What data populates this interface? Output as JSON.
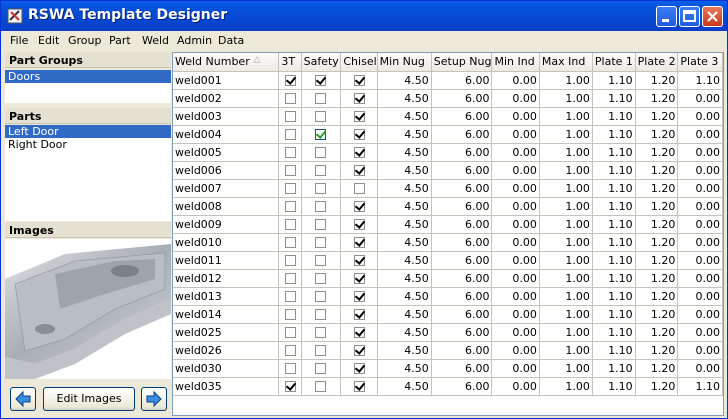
{
  "window": {
    "title": "RSWA Template Designer"
  },
  "menu": [
    "File",
    "Edit",
    "Group",
    "Part",
    "Weld",
    "Admin",
    "Data"
  ],
  "part_groups": {
    "header": "Part Groups",
    "items": [
      "Doors"
    ],
    "selected": 0
  },
  "parts": {
    "header": "Parts",
    "items": [
      "Left Door",
      "Right Door"
    ],
    "selected": 0
  },
  "images": {
    "header": "Images",
    "edit_button": "Edit Images"
  },
  "table": {
    "columns": [
      "Weld Number",
      "3T",
      "Safety",
      "Chisel",
      "Min Nug",
      "Setup Nug",
      "Min Ind",
      "Max Ind",
      "Plate 1",
      "Plate 2",
      "Plate 3"
    ],
    "rows": [
      {
        "weld": "weld001",
        "t3": true,
        "safety": true,
        "chisel": true,
        "min_nug": "4.50",
        "setup_nug": "6.00",
        "min_ind": "0.00",
        "max_ind": "1.00",
        "p1": "1.10",
        "p2": "1.20",
        "p3": "1.10"
      },
      {
        "weld": "weld002",
        "t3": false,
        "safety": false,
        "chisel": true,
        "min_nug": "4.50",
        "setup_nug": "6.00",
        "min_ind": "0.00",
        "max_ind": "1.00",
        "p1": "1.10",
        "p2": "1.20",
        "p3": "0.00"
      },
      {
        "weld": "weld003",
        "t3": false,
        "safety": false,
        "chisel": true,
        "min_nug": "4.50",
        "setup_nug": "6.00",
        "min_ind": "0.00",
        "max_ind": "1.00",
        "p1": "1.10",
        "p2": "1.20",
        "p3": "0.00"
      },
      {
        "weld": "weld004",
        "t3": false,
        "safety": true,
        "chisel": true,
        "min_nug": "4.50",
        "setup_nug": "6.00",
        "min_ind": "0.00",
        "max_ind": "1.00",
        "p1": "1.10",
        "p2": "1.20",
        "p3": "0.00",
        "safety_focus": true
      },
      {
        "weld": "weld005",
        "t3": false,
        "safety": false,
        "chisel": true,
        "min_nug": "4.50",
        "setup_nug": "6.00",
        "min_ind": "0.00",
        "max_ind": "1.00",
        "p1": "1.10",
        "p2": "1.20",
        "p3": "0.00"
      },
      {
        "weld": "weld006",
        "t3": false,
        "safety": false,
        "chisel": true,
        "min_nug": "4.50",
        "setup_nug": "6.00",
        "min_ind": "0.00",
        "max_ind": "1.00",
        "p1": "1.10",
        "p2": "1.20",
        "p3": "0.00"
      },
      {
        "weld": "weld007",
        "t3": false,
        "safety": false,
        "chisel": false,
        "min_nug": "4.50",
        "setup_nug": "6.00",
        "min_ind": "0.00",
        "max_ind": "1.00",
        "p1": "1.10",
        "p2": "1.20",
        "p3": "0.00"
      },
      {
        "weld": "weld008",
        "t3": false,
        "safety": false,
        "chisel": true,
        "min_nug": "4.50",
        "setup_nug": "6.00",
        "min_ind": "0.00",
        "max_ind": "1.00",
        "p1": "1.10",
        "p2": "1.20",
        "p3": "0.00"
      },
      {
        "weld": "weld009",
        "t3": false,
        "safety": false,
        "chisel": true,
        "min_nug": "4.50",
        "setup_nug": "6.00",
        "min_ind": "0.00",
        "max_ind": "1.00",
        "p1": "1.10",
        "p2": "1.20",
        "p3": "0.00"
      },
      {
        "weld": "weld010",
        "t3": false,
        "safety": false,
        "chisel": true,
        "min_nug": "4.50",
        "setup_nug": "6.00",
        "min_ind": "0.00",
        "max_ind": "1.00",
        "p1": "1.10",
        "p2": "1.20",
        "p3": "0.00"
      },
      {
        "weld": "weld011",
        "t3": false,
        "safety": false,
        "chisel": true,
        "min_nug": "4.50",
        "setup_nug": "6.00",
        "min_ind": "0.00",
        "max_ind": "1.00",
        "p1": "1.10",
        "p2": "1.20",
        "p3": "0.00"
      },
      {
        "weld": "weld012",
        "t3": false,
        "safety": false,
        "chisel": true,
        "min_nug": "4.50",
        "setup_nug": "6.00",
        "min_ind": "0.00",
        "max_ind": "1.00",
        "p1": "1.10",
        "p2": "1.20",
        "p3": "0.00"
      },
      {
        "weld": "weld013",
        "t3": false,
        "safety": false,
        "chisel": true,
        "min_nug": "4.50",
        "setup_nug": "6.00",
        "min_ind": "0.00",
        "max_ind": "1.00",
        "p1": "1.10",
        "p2": "1.20",
        "p3": "0.00"
      },
      {
        "weld": "weld014",
        "t3": false,
        "safety": false,
        "chisel": true,
        "min_nug": "4.50",
        "setup_nug": "6.00",
        "min_ind": "0.00",
        "max_ind": "1.00",
        "p1": "1.10",
        "p2": "1.20",
        "p3": "0.00"
      },
      {
        "weld": "weld025",
        "t3": false,
        "safety": false,
        "chisel": true,
        "min_nug": "4.50",
        "setup_nug": "6.00",
        "min_ind": "0.00",
        "max_ind": "1.00",
        "p1": "1.10",
        "p2": "1.20",
        "p3": "0.00"
      },
      {
        "weld": "weld026",
        "t3": false,
        "safety": false,
        "chisel": true,
        "min_nug": "4.50",
        "setup_nug": "6.00",
        "min_ind": "0.00",
        "max_ind": "1.00",
        "p1": "1.10",
        "p2": "1.20",
        "p3": "0.00"
      },
      {
        "weld": "weld030",
        "t3": false,
        "safety": false,
        "chisel": true,
        "min_nug": "4.50",
        "setup_nug": "6.00",
        "min_ind": "0.00",
        "max_ind": "1.00",
        "p1": "1.10",
        "p2": "1.20",
        "p3": "0.00"
      },
      {
        "weld": "weld035",
        "t3": true,
        "safety": false,
        "chisel": true,
        "min_nug": "4.50",
        "setup_nug": "6.00",
        "min_ind": "0.00",
        "max_ind": "1.00",
        "p1": "1.10",
        "p2": "1.20",
        "p3": "1.10"
      }
    ]
  }
}
